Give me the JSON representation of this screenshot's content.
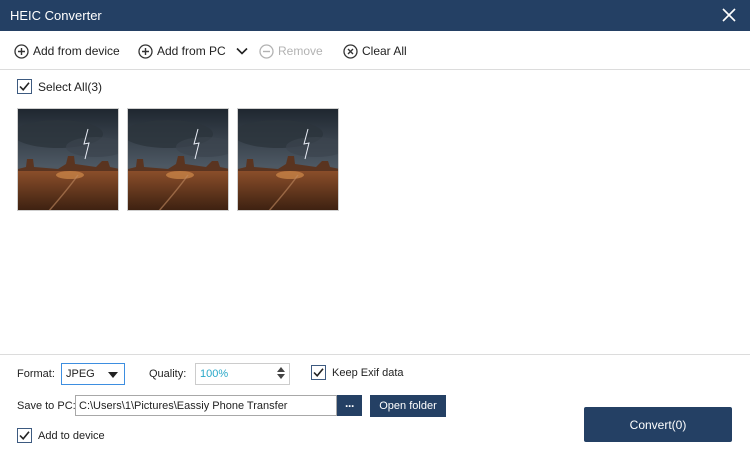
{
  "window": {
    "title": "HEIC Converter"
  },
  "toolbar": {
    "add_from_device": "Add from device",
    "add_from_pc": "Add from PC",
    "remove": "Remove",
    "clear_all": "Clear All"
  },
  "list": {
    "select_all": "Select All(3)",
    "select_all_checked": true,
    "thumbnails": [
      {
        "icon": "landscape-photo"
      },
      {
        "icon": "landscape-photo"
      },
      {
        "icon": "landscape-photo"
      }
    ]
  },
  "settings": {
    "format_label": "Format:",
    "format_value": "JPEG",
    "quality_label": "Quality:",
    "quality_value": "100%",
    "keep_exif_label": "Keep Exif data",
    "keep_exif_checked": true,
    "save_to_pc_label": "Save to PC:",
    "save_path": "C:\\Users\\1\\Pictures\\Eassiy Phone Transfer",
    "browse_label": "···",
    "open_folder_label": "Open folder",
    "add_to_device_label": "Add to device",
    "add_to_device_checked": true,
    "convert_label": "Convert(0)"
  },
  "colors": {
    "primary": "#244064",
    "accent_text": "#2aa8c8",
    "focus_border": "#3d8ee0",
    "disabled_text": "#b2b2b2"
  }
}
